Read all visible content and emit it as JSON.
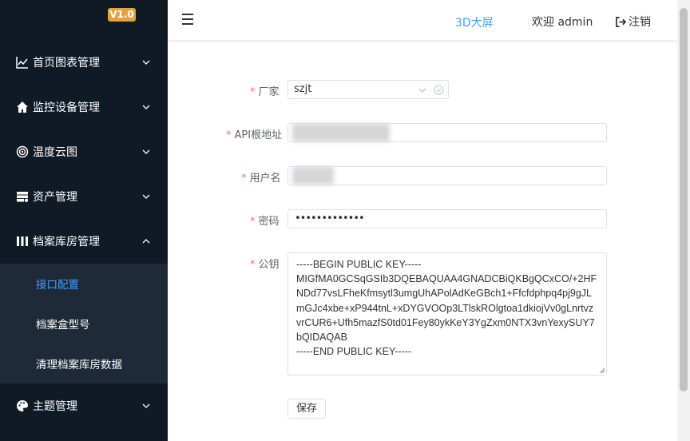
{
  "sidebar": {
    "version": "V1.0",
    "menus": [
      {
        "label": "首页图表管理",
        "icon": "line-chart-icon"
      },
      {
        "label": "监控设备管理",
        "icon": "home-icon"
      },
      {
        "label": "温度云图",
        "icon": "target-icon"
      },
      {
        "label": "资产管理",
        "icon": "server-icon"
      },
      {
        "label": "档案库房管理",
        "icon": "columns-icon"
      },
      {
        "label": "主题管理",
        "icon": "palette-icon"
      }
    ],
    "submenu": [
      {
        "label": "接口配置",
        "active": true
      },
      {
        "label": "档案盒型号",
        "active": false
      },
      {
        "label": "清理档案库房数据",
        "active": false
      }
    ]
  },
  "header": {
    "screen_3d": "3D大屏",
    "welcome": "欢迎 admin",
    "logout": "注销"
  },
  "form": {
    "vendor_label": "厂家",
    "vendor_value": "szjt",
    "api_label": "API根地址",
    "username_label": "用户名",
    "password_label": "密码",
    "password_value": "•••••••••••••",
    "pubkey_label": "公钥",
    "pubkey_value": "-----BEGIN PUBLIC KEY-----\nMIGfMA0GCSqGSIb3DQEBAQUAA4GNADCBiQKBgQCxCO/+2HFNDd77vsLFheKfmsytl3umgUhAPolAdKeGBch1+Ffcfdphpq4pj9gJLmGJc4xbe+xP944tnL+xDYGVOOp3LTlskROlgtoa1dkiojVv0gLnrtvzvrCUR6+Ufh5mazfS0td01Fey80ykKeY3YgZxm0NTX3vnYexySUY7bQIDAQAB\n-----END PUBLIC KEY-----",
    "save_label": "保存"
  },
  "colors": {
    "sidebar_bg": "#0f1a24",
    "submenu_bg": "#1e2a38",
    "accent": "#409eff",
    "badge": "#e6a23c",
    "required": "#f56c6c"
  }
}
